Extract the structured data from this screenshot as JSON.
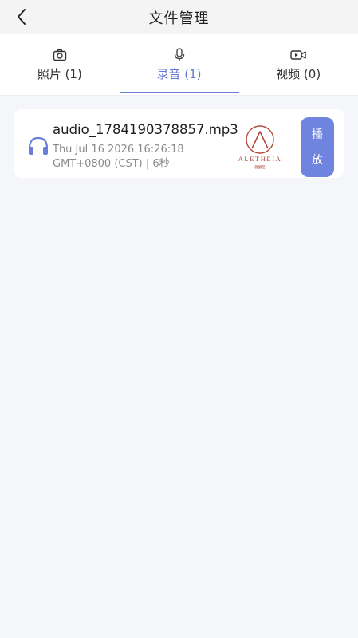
{
  "header": {
    "title": "文件管理",
    "back_icon": "chevron-left-icon"
  },
  "tabs": [
    {
      "label": "照片 (1)",
      "icon": "camera-icon",
      "active": false
    },
    {
      "label": "录音 (1)",
      "icon": "microphone-icon",
      "active": true
    },
    {
      "label": "视频 (0)",
      "icon": "video-icon",
      "active": false
    }
  ],
  "colors": {
    "accent": "#6a7ed8",
    "play_button": "#6f84df",
    "logo": "#b5473b"
  },
  "recordings": [
    {
      "file_name": "audio_1784190378857.mp3",
      "date_line": "Thu Jul 16 2026 16:26:18",
      "meta_line": "GMT+0800 (CST) | 6秒",
      "icon": "headphones-icon",
      "logo_text": "ALETHEIA",
      "logo_subtext": "雅瑟亚",
      "play_label_1": "播",
      "play_label_2": "放"
    }
  ]
}
